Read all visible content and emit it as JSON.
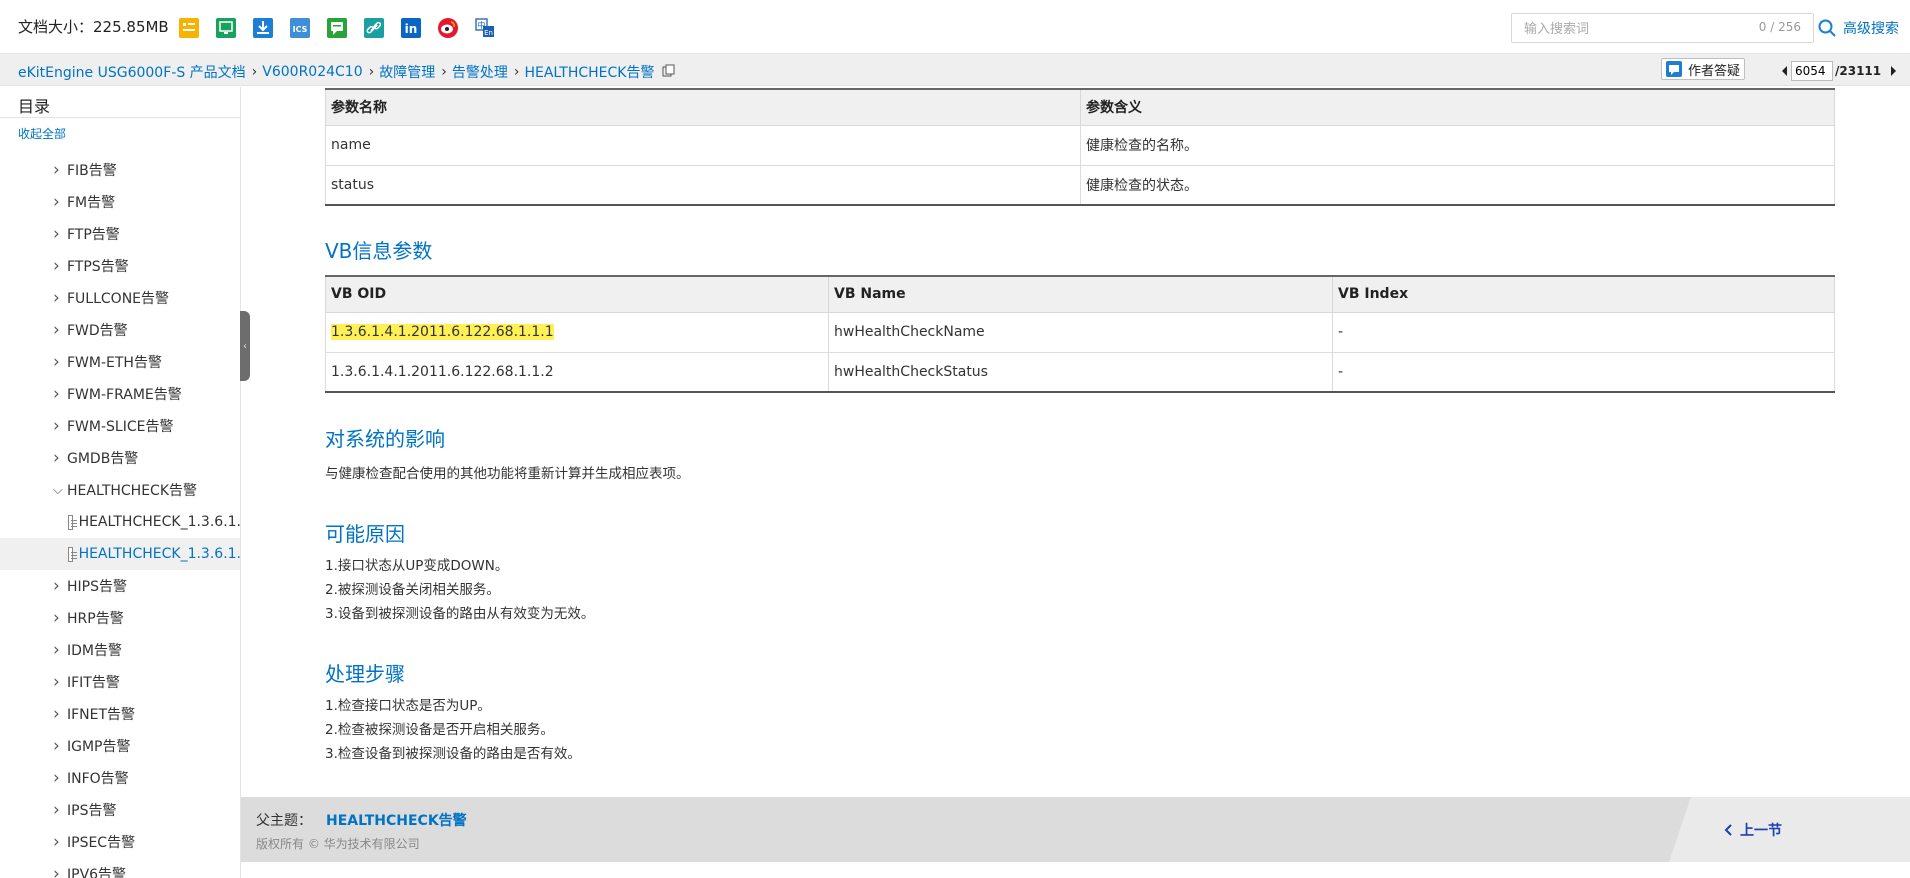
{
  "topbar": {
    "doc_size": "文档大小：225.85MB",
    "search_placeholder": "输入搜索词",
    "search_count": "0 / 256",
    "advanced_search": "高级搜索",
    "icons": [
      {
        "name": "bookmark-icon",
        "color": "#f6b400"
      },
      {
        "name": "screen-icon",
        "color": "#19a15f"
      },
      {
        "name": "download-icon",
        "color": "#1e7ed7"
      },
      {
        "name": "ics-icon",
        "color": "#3f8fd8"
      },
      {
        "name": "comment-icon",
        "color": "#27a33a"
      },
      {
        "name": "link-icon",
        "color": "#1aa0a0"
      },
      {
        "name": "linkedin-icon",
        "color": "#0a66c2"
      },
      {
        "name": "weibo-icon",
        "color": "#e6162d"
      },
      {
        "name": "translate-icon",
        "color": "#1a5fb4"
      }
    ]
  },
  "breadcrumb": {
    "items": [
      "eKitEngine USG6000F-S 产品文档",
      "V600R024C10",
      "故障管理",
      "告警处理",
      "HEALTHCHECK告警"
    ]
  },
  "feedback_button": "作者答疑",
  "pager": {
    "current": "6054",
    "total": "/23111"
  },
  "sidebar": {
    "title": "目录",
    "collapse_all": "收起全部",
    "items": [
      {
        "label": "FIB告警",
        "level": 1,
        "expanded": false
      },
      {
        "label": "FM告警",
        "level": 1,
        "expanded": false
      },
      {
        "label": "FTP告警",
        "level": 1,
        "expanded": false
      },
      {
        "label": "FTPS告警",
        "level": 1,
        "expanded": false
      },
      {
        "label": "FULLCONE告警",
        "level": 1,
        "expanded": false
      },
      {
        "label": "FWD告警",
        "level": 1,
        "expanded": false
      },
      {
        "label": "FWM-ETH告警",
        "level": 1,
        "expanded": false
      },
      {
        "label": "FWM-FRAME告警",
        "level": 1,
        "expanded": false
      },
      {
        "label": "FWM-SLICE告警",
        "level": 1,
        "expanded": false
      },
      {
        "label": "GMDB告警",
        "level": 1,
        "expanded": false
      },
      {
        "label": "HEALTHCHECK告警",
        "level": 1,
        "expanded": true
      },
      {
        "label": "HEALTHCHECK_1.3.6.1.",
        "level": 2,
        "leaf": true
      },
      {
        "label": "HEALTHCHECK_1.3.6.1.",
        "level": 2,
        "leaf": true,
        "selected": true
      },
      {
        "label": "HIPS告警",
        "level": 1,
        "expanded": false
      },
      {
        "label": "HRP告警",
        "level": 1,
        "expanded": false
      },
      {
        "label": "IDM告警",
        "level": 1,
        "expanded": false
      },
      {
        "label": "IFIT告警",
        "level": 1,
        "expanded": false
      },
      {
        "label": "IFNET告警",
        "level": 1,
        "expanded": false
      },
      {
        "label": "IGMP告警",
        "level": 1,
        "expanded": false
      },
      {
        "label": "INFO告警",
        "level": 1,
        "expanded": false
      },
      {
        "label": "IPS告警",
        "level": 1,
        "expanded": false
      },
      {
        "label": "IPSEC告警",
        "level": 1,
        "expanded": false
      },
      {
        "label": "IPV6告警",
        "level": 1,
        "expanded": false
      }
    ]
  },
  "content": {
    "param_table": {
      "headers": [
        "参数名称",
        "参数含义"
      ],
      "rows": [
        [
          "name",
          "健康检查的名称。"
        ],
        [
          "status",
          "健康检查的状态。"
        ]
      ]
    },
    "vb_heading": "VB信息参数",
    "vb_table": {
      "headers": [
        "VB OID",
        "VB Name",
        "VB Index"
      ],
      "rows": [
        [
          "1.3.6.1.4.1.2011.6.122.68.1.1.1",
          "hwHealthCheckName",
          "-"
        ],
        [
          "1.3.6.1.4.1.2011.6.122.68.1.1.2",
          "hwHealthCheckStatus",
          "-"
        ]
      ]
    },
    "impact_heading": "对系统的影响",
    "impact_text": "与健康检查配合使用的其他功能将重新计算并生成相应表项。",
    "causes_heading": "可能原因",
    "causes": [
      "1.接口状态从UP变成DOWN。",
      "2.被探测设备关闭相关服务。",
      "3.设备到被探测设备的路由从有效变为无效。"
    ],
    "steps_heading": "处理步骤",
    "steps": [
      "1.检查接口状态是否为UP。",
      "2.检查被探测设备是否开启相关服务。",
      "3.检查设备到被探测设备的路由是否有效。"
    ]
  },
  "footer": {
    "parent_label": "父主题：",
    "parent_link": "HEALTHCHECK告警",
    "copyright": "版权所有 © 华为技术有限公司",
    "prev": "上一节"
  }
}
